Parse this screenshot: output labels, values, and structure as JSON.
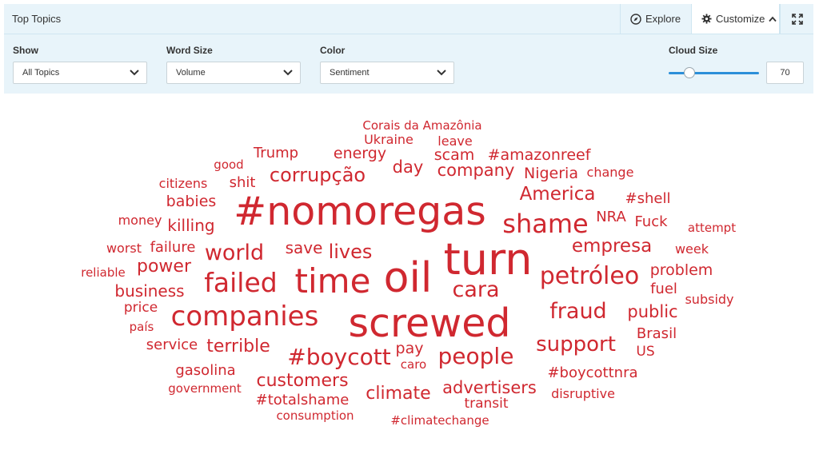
{
  "header": {
    "title": "Top Topics",
    "explore_label": "Explore",
    "customize_label": "Customize"
  },
  "controls": {
    "show": {
      "label": "Show",
      "value": "All Topics"
    },
    "word_size": {
      "label": "Word Size",
      "value": "Volume"
    },
    "color": {
      "label": "Color",
      "value": "Sentiment"
    },
    "cloud_size": {
      "label": "Cloud Size",
      "value": "70",
      "slider_fraction": 0.23
    }
  },
  "colors": {
    "word": "#d02830",
    "accent": "#2b8fd9",
    "panel_bg": "#e8f4fa"
  },
  "cloud": {
    "words": [
      "Corais da Amazônia",
      "Ukraine",
      "leave",
      "energy",
      "Trump",
      "scam",
      "#amazonreef",
      "good",
      "day",
      "company",
      "corrupção",
      "Nigeria",
      "change",
      "citizens",
      "shit",
      "America",
      "#shell",
      "babies",
      "#nomoregas",
      "money",
      "killing",
      "NRA",
      "Fuck",
      "shame",
      "attempt",
      "worst",
      "failure",
      "save",
      "lives",
      "empresa",
      "week",
      "world",
      "turn",
      "reliable",
      "power",
      "problem",
      "failed",
      "time",
      "oil",
      "petróleo",
      "business",
      "cara",
      "fuel",
      "subsidy",
      "price",
      "fraud",
      "public",
      "companies",
      "país",
      "screwed",
      "Brasil",
      "service",
      "terrible",
      "support",
      "pay",
      "US",
      "#boycott",
      "people",
      "caro",
      "gasolina",
      "#boycottnra",
      "customers",
      "government",
      "advertisers",
      "climate",
      "disruptive",
      "transit",
      "#totalshame",
      "consumption",
      "#climatechange"
    ]
  }
}
